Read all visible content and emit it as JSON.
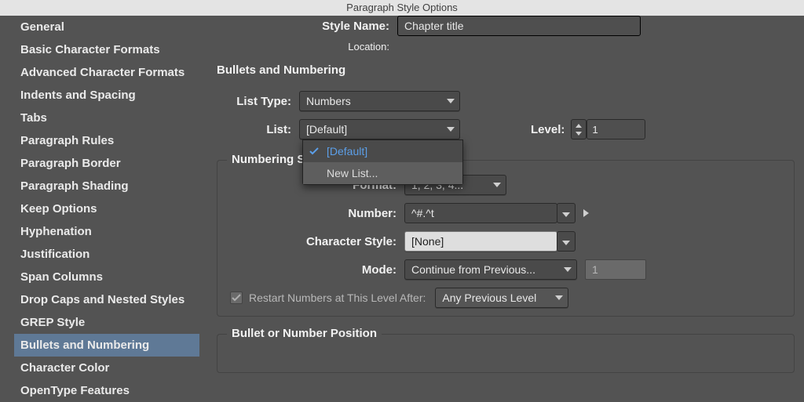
{
  "title": "Paragraph Style Options",
  "header": {
    "style_name_label": "Style Name:",
    "style_name_value": "Chapter title",
    "location_label": "Location:"
  },
  "sidebar": {
    "items": [
      "General",
      "Basic Character Formats",
      "Advanced Character Formats",
      "Indents and Spacing",
      "Tabs",
      "Paragraph Rules",
      "Paragraph Border",
      "Paragraph Shading",
      "Keep Options",
      "Hyphenation",
      "Justification",
      "Span Columns",
      "Drop Caps and Nested Styles",
      "GREP Style",
      "Bullets and Numbering",
      "Character Color",
      "OpenType Features"
    ],
    "selected_index": 14
  },
  "main": {
    "section_title": "Bullets and Numbering",
    "list_type_label": "List Type:",
    "list_type_value": "Numbers",
    "list_label": "List:",
    "list_value": "[Default]",
    "list_dropdown": {
      "items": [
        "[Default]",
        "New List..."
      ],
      "selected_index": 0,
      "highlighted_index": 1
    },
    "level_label": "Level:",
    "level_value": "1",
    "numbering_group_title": "Numbering St",
    "format_label": "Format:",
    "format_value": "1, 2, 3, 4...",
    "number_label": "Number:",
    "number_value": "^#.^t",
    "char_style_label": "Character Style:",
    "char_style_value": "[None]",
    "mode_label": "Mode:",
    "mode_value": "Continue from Previous...",
    "mode_start_value": "1",
    "restart_label": "Restart Numbers at This Level After:",
    "restart_value": "Any Previous Level",
    "bullet_pos_group_title": "Bullet or Number Position"
  }
}
